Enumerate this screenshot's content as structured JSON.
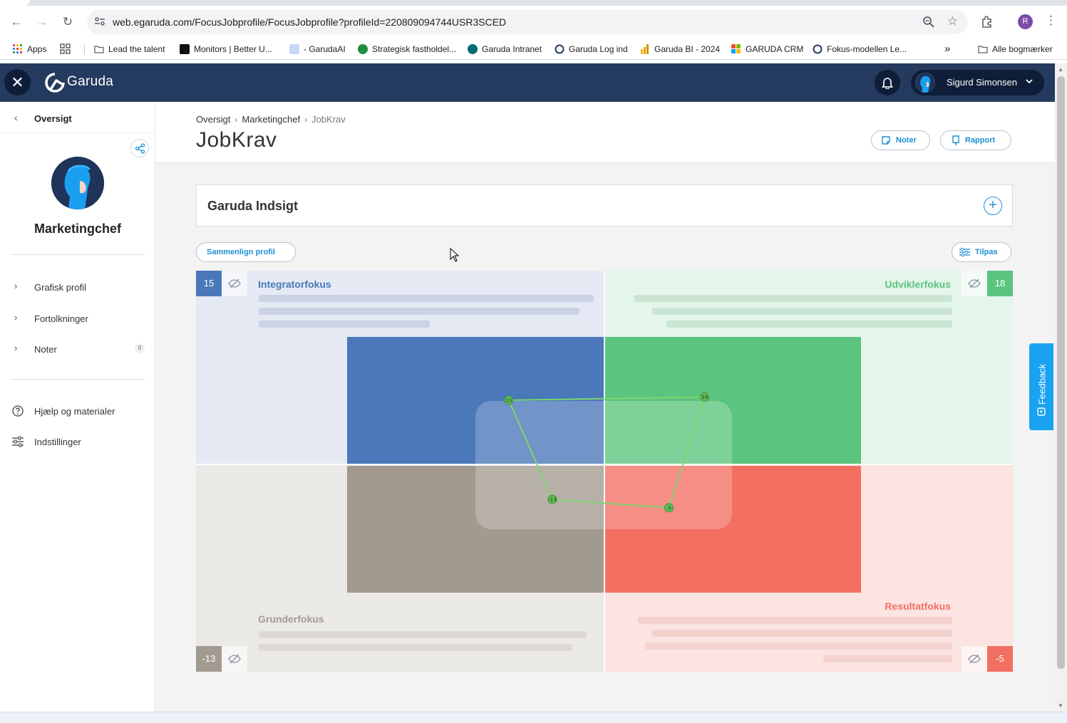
{
  "browser": {
    "url": "web.egaruda.com/FocusJobprofile/FocusJobprofile?profileId=220809094744USR3SCED",
    "profile_initial": "R",
    "bookmarks": [
      {
        "label": "Apps",
        "color": "#ea4335"
      },
      {
        "label": "Lead the talent",
        "color": "#5f6368"
      },
      {
        "label": "Monitors | Better U...",
        "color": "#111111"
      },
      {
        "label": "- GarudaAI",
        "color": "#8ab4f8"
      },
      {
        "label": "Strategisk fastholdel...",
        "color": "#1e8e3e"
      },
      {
        "label": "Garuda Intranet",
        "color": "#036c70"
      },
      {
        "label": "Garuda Log ind",
        "color": "#243a5e"
      },
      {
        "label": "Garuda BI - 2024",
        "color": "#f2b600"
      },
      {
        "label": "GARUDA CRM",
        "color": "#f25022"
      },
      {
        "label": "Fokus-modellen Le...",
        "color": "#243a5e"
      }
    ],
    "all_bookmarks": "Alle bogmærker"
  },
  "header": {
    "logo": "Garuda",
    "user_name": "Sigurd Simonsen"
  },
  "sidebar": {
    "back_label": "Oversigt",
    "profile_title": "Marketingchef",
    "items": [
      {
        "label": "Grafisk profil"
      },
      {
        "label": "Fortolkninger"
      },
      {
        "label": "Noter",
        "badge": "0"
      }
    ],
    "help_label": "Hjælp og materialer",
    "settings_label": "Indstillinger"
  },
  "main": {
    "breadcrumb": [
      "Oversigt",
      "Marketingchef",
      "JobKrav"
    ],
    "title": "JobKrav",
    "noter_btn": "Noter",
    "rapport_btn": "Rapport",
    "insight_title": "Garuda Indsigt",
    "compare_btn": "Sammenlign profil",
    "tilpas_btn": "Tilpas"
  },
  "chart_data": {
    "type": "radar-quadrant",
    "quadrants": [
      {
        "name": "Integratorfokus",
        "value": 15,
        "color": "#4a78b9"
      },
      {
        "name": "Udviklerfokus",
        "value": 18,
        "color": "#5bc47e"
      },
      {
        "name": "Resultatfokus",
        "value": -5,
        "color": "#f26f62"
      },
      {
        "name": "Grunderfokus",
        "value": -13,
        "color": "#a29a8f"
      }
    ],
    "line_color": "#7ed56f"
  },
  "feedback_label": "Feedback"
}
